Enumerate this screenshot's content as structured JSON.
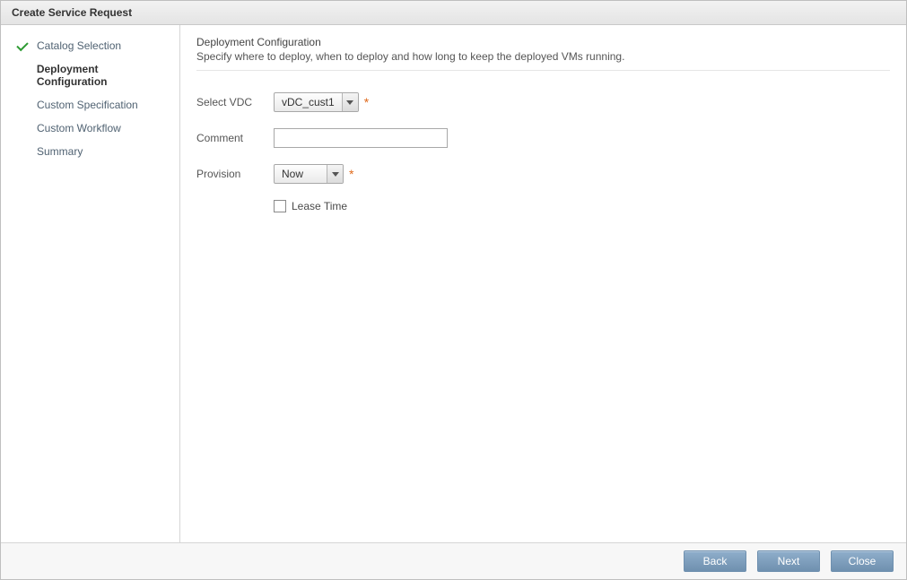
{
  "title": "Create Service Request",
  "sidebar": {
    "items": [
      {
        "label": "Catalog Selection",
        "state": "completed"
      },
      {
        "label": "Deployment Configuration",
        "state": "active"
      },
      {
        "label": "Custom Specification",
        "state": "pending"
      },
      {
        "label": "Custom Workflow",
        "state": "pending"
      },
      {
        "label": "Summary",
        "state": "pending"
      }
    ]
  },
  "main": {
    "heading": "Deployment Configuration",
    "subheading": "Specify where to deploy, when to deploy and how long to keep the deployed VMs running.",
    "form": {
      "select_vdc": {
        "label": "Select VDC",
        "value": "vDC_cust1",
        "required_mark": "*"
      },
      "comment": {
        "label": "Comment",
        "value": ""
      },
      "provision": {
        "label": "Provision",
        "value": "Now",
        "required_mark": "*"
      },
      "lease_time": {
        "label": "Lease Time",
        "checked": false
      }
    }
  },
  "footer": {
    "back": "Back",
    "next": "Next",
    "close": "Close"
  }
}
